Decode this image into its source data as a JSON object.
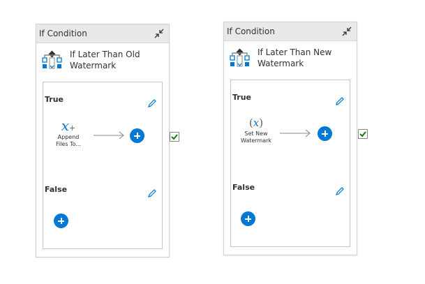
{
  "cards": [
    {
      "header_title": "If Condition",
      "activity_name": "If Later Than Old Watermark",
      "true_label": "True",
      "false_label": "False",
      "true_activity_name": "Append Files To...",
      "true_activity_icon": "variable-x-plus-icon"
    },
    {
      "header_title": "If Condition",
      "activity_name": "If Later Than New Watermark",
      "true_label": "True",
      "false_label": "False",
      "true_activity_name": "Set New Watermark",
      "true_activity_icon": "variable-x-parentheses-icon"
    }
  ],
  "colors": {
    "accent": "#0078d4",
    "check": "#107c10",
    "header_bg": "#e9e9e9"
  }
}
